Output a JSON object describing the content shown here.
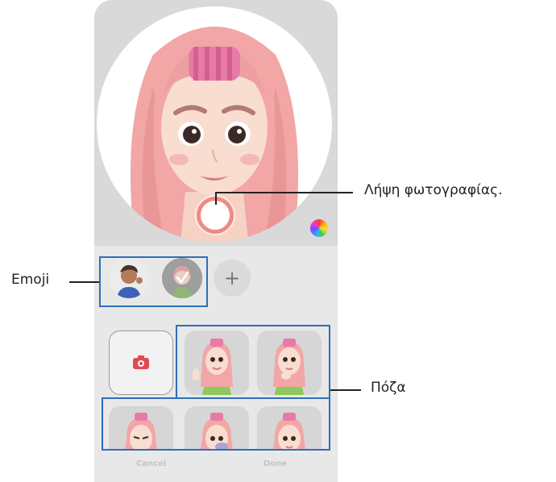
{
  "callouts": {
    "capture_photo": "Λήψη φωτογραφίας.",
    "emoji": "Emoji",
    "poses": "Πόζα"
  },
  "emoji_row": {
    "add_symbol": "+"
  },
  "bottom_bar": {
    "cancel_label": "Cancel",
    "done_label": "Done"
  },
  "colors": {
    "callout_border": "#2d6fb8",
    "shutter_ring": "#f08a84",
    "record_icon": "#e04a52"
  },
  "icons": {
    "color_wheel": "color-palette-icon",
    "camera": "camera-icon",
    "add": "plus-icon"
  }
}
